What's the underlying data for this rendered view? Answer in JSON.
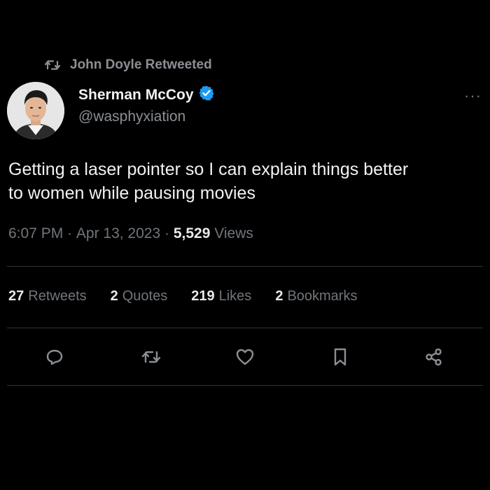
{
  "retweet_notice": {
    "text": "John Doyle Retweeted",
    "icon": "retweet-icon"
  },
  "author": {
    "name": "Sherman McCoy",
    "handle": "@wasphyxiation",
    "verified_icon": "verified-badge-icon",
    "avatar": "profile-photo"
  },
  "more_icon_label": "···",
  "tweet": {
    "text_lines": [
      "Getting a laser pointer so I can explain things better",
      "to women while pausing movies"
    ]
  },
  "meta": {
    "time": "6:07 PM",
    "separator": " · ",
    "date": "Apr 13, 2023",
    "views_count": "5,529",
    "views_label": " Views"
  },
  "stats": [
    {
      "count": "27",
      "label": "Retweets"
    },
    {
      "count": "2",
      "label": "Quotes"
    },
    {
      "count": "219",
      "label": "Likes"
    },
    {
      "count": "2",
      "label": "Bookmarks"
    }
  ],
  "actions": [
    {
      "icon": "reply-icon"
    },
    {
      "icon": "retweet-icon"
    },
    {
      "icon": "like-heart-icon"
    },
    {
      "icon": "bookmark-icon"
    },
    {
      "icon": "share-icon"
    }
  ],
  "colors": {
    "background": "#000000",
    "primary_text": "#e7e9ea",
    "secondary_text": "#71767b",
    "divider": "#2f3336",
    "verified_blue": "#1d9bf0"
  }
}
